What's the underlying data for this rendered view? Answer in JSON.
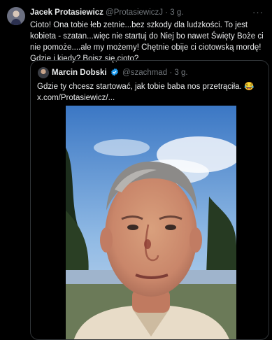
{
  "tweet": {
    "author_name": "Jacek Protasiewicz",
    "author_handle": "@ProtasiewiczJ",
    "separator": "·",
    "time": "3 g.",
    "more_icon": "more-dots-icon",
    "text": "Cioto! Ona tobie łeb zetnie...bez szkody dla ludzkości. To jest kobieta - szatan...więc nie startuj do Niej bo nawet Święty Boże ci nie pomoże....ale my możemy! Chętnie obije ci ciotowską mordę! Gdzie i kiedy? Boisz się,cioto?"
  },
  "quoted": {
    "author_name": "Marcin Dobski",
    "author_handle": "@szachmad",
    "separator": "·",
    "time": "3 g.",
    "verified_icon": "verified-badge-icon",
    "verified_color": "#1d9bf0",
    "text": "Gdzie ty chcesz startować, jak tobie baba nos przetrąciła. 😂 x.com/Protasiewicz/..."
  }
}
